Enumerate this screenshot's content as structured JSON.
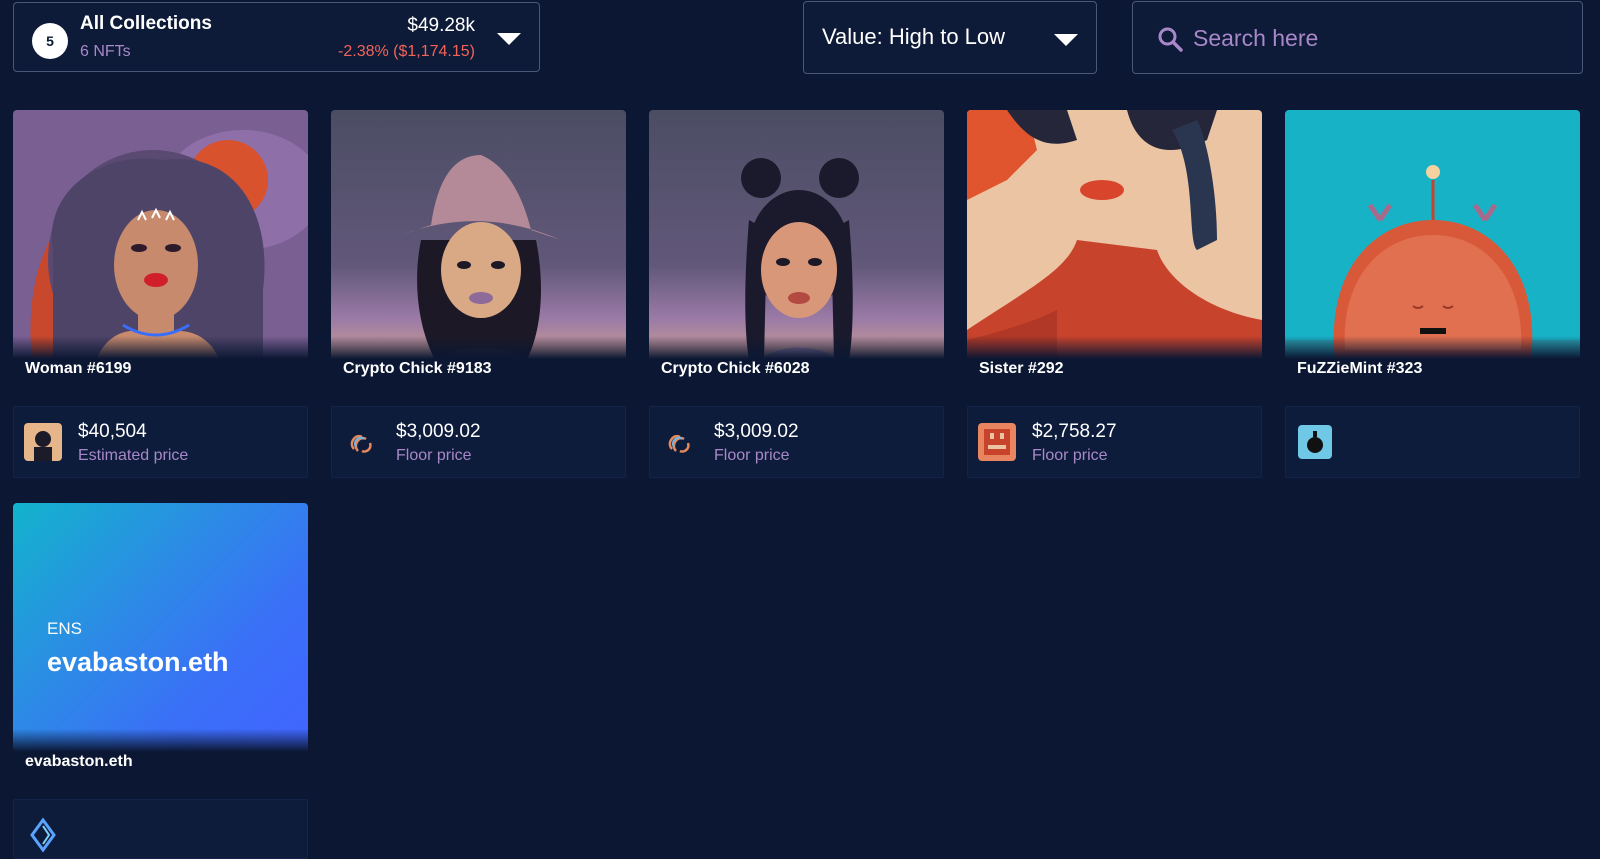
{
  "collections": {
    "count": "5",
    "title": "All Collections",
    "subtitle": "6 NFTs",
    "value": "$49.28k",
    "change": "-2.38% ($1,174.15)"
  },
  "sort": {
    "label": "Value: High to Low"
  },
  "search": {
    "placeholder": "Search here"
  },
  "cards": [
    {
      "name": "Woman #6199",
      "price": "$40,504",
      "price_label": "Estimated price"
    },
    {
      "name": "Crypto Chick #9183",
      "price": "$3,009.02",
      "price_label": "Floor price"
    },
    {
      "name": "Crypto Chick #6028",
      "price": "$3,009.02",
      "price_label": "Floor price"
    },
    {
      "name": "Sister #292",
      "price": "$2,758.27",
      "price_label": "Floor price"
    },
    {
      "name": "FuZZieMint #323",
      "price": "",
      "price_label": ""
    },
    {
      "name": "evabaston.eth",
      "price": "",
      "price_label": "",
      "ens_small": "ENS",
      "ens_big": "evabaston.eth"
    }
  ],
  "colors": {
    "background": "#0b1733",
    "accent_text": "#a888c8",
    "negative": "#f2645a"
  }
}
